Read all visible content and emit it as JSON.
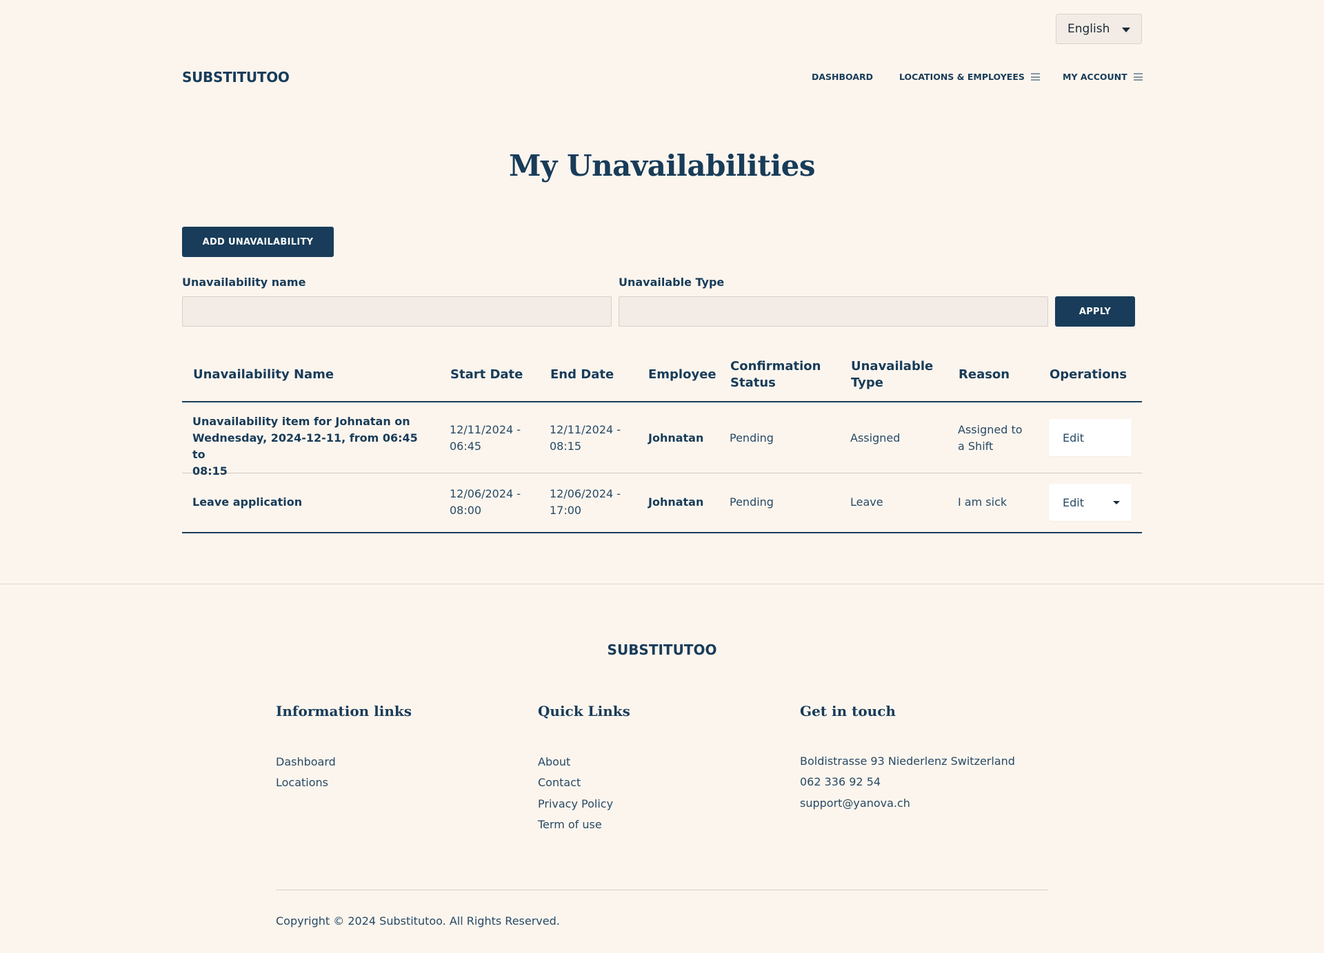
{
  "language": {
    "selected": "English"
  },
  "header": {
    "logo": "SUBSTITUTOO",
    "nav": {
      "dashboard": "DASHBOARD",
      "locations": "LOCATIONS & EMPLOYEES",
      "account": "MY ACCOUNT"
    }
  },
  "page": {
    "title": "My Unavailabilities",
    "add_button": "ADD UNAVAILABILITY"
  },
  "filters": {
    "name_label": "Unavailability name",
    "name_value": "",
    "type_label": "Unavailable Type",
    "type_value": "",
    "apply": "APPLY"
  },
  "table": {
    "headers": {
      "name": "Unavailability Name",
      "start": "Start Date",
      "end": "End Date",
      "employee": "Employee",
      "status_1": "Confirmation",
      "status_2": "Status",
      "type_1": "Unavailable",
      "type_2": "Type",
      "reason": "Reason",
      "ops": "Operations"
    },
    "rows": [
      {
        "name_1": "Unavailability item for Johnatan on",
        "name_2": "Wednesday, 2024-12-11, from 06:45 to",
        "name_3": "08:15",
        "start_1": "12/11/2024 -",
        "start_2": "06:45",
        "end_1": "12/11/2024 -",
        "end_2": "08:15",
        "employee": "Johnatan",
        "status": "Pending",
        "type": "Assigned",
        "reason_1": "Assigned to",
        "reason_2": "a Shift",
        "op": "Edit"
      },
      {
        "name_1": "Leave application",
        "start_1": "12/06/2024 -",
        "start_2": "08:00",
        "end_1": "12/06/2024 -",
        "end_2": "17:00",
        "employee": "Johnatan",
        "status": "Pending",
        "type": "Leave",
        "reason_1": "I am sick",
        "op": "Edit"
      }
    ]
  },
  "footer": {
    "logo": "SUBSTITUTOO",
    "info_heading": "Information links",
    "info_links": [
      "Dashboard",
      "Locations"
    ],
    "quick_heading": "Quick Links",
    "quick_links": [
      "About",
      "Contact",
      "Privacy Policy",
      "Term of use"
    ],
    "contact_heading": "Get in touch",
    "address": "Boldistrasse 93 Niederlenz Switzerland",
    "phone": "062 336 92 54",
    "email": "support@yanova.ch",
    "copyright": "Copyright © 2024 Substitutoo. All Rights Reserved."
  }
}
